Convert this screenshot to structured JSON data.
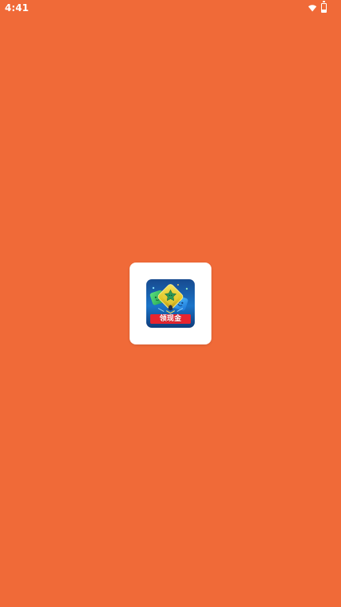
{
  "status_bar": {
    "time": "4:41",
    "icons": [
      "wifi-icon",
      "battery-icon"
    ],
    "battery_level": 0.35
  },
  "app_icon": {
    "label": "领现金"
  },
  "colors": {
    "background": "#F06A38",
    "status_text": "#FFFFFF",
    "card_background": "#FFFFFF",
    "badge_red": "#E8242E"
  }
}
